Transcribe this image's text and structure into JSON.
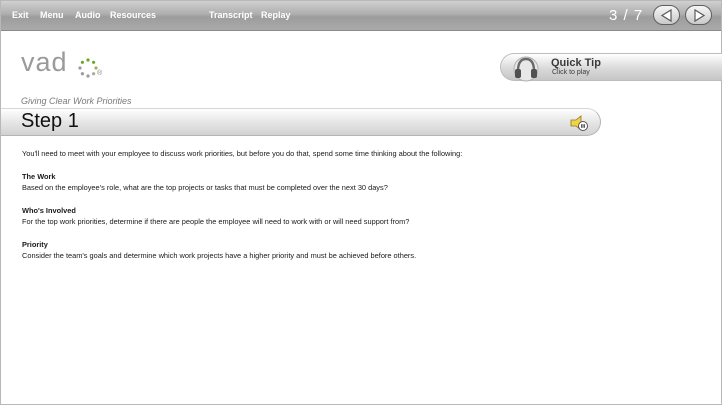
{
  "toolbar": {
    "items": [
      "Exit",
      "Menu",
      "Audio",
      "Resources",
      "Transcript",
      "Replay"
    ],
    "page_indicator": "3 / 7",
    "prev_icon": "triangle-left-icon",
    "next_icon": "triangle-right-icon"
  },
  "logo": {
    "text": "vad",
    "mark_icon": "dotted-o-logo-icon",
    "registered": "®"
  },
  "quick_tip": {
    "title": "Quick Tip",
    "subtitle": "Click to play",
    "icon": "headphones-icon"
  },
  "lesson": {
    "subtitle": "Giving Clear Work Priorities",
    "step_title": "Step 1",
    "step_icon": "audio-speaker-icon"
  },
  "content": {
    "intro": "You'll need to meet with your employee to discuss work priorities, but before you do that, spend some time thinking about the following:",
    "sections": [
      {
        "heading": "The Work",
        "text": "Based on the employee's role, what are the top projects or tasks that must be completed over the next 30 days?"
      },
      {
        "heading": "Who's Involved",
        "text": "For the top work priorities, determine if there are people the employee will need to work with or will need support from?"
      },
      {
        "heading": "Priority",
        "text": "Consider the team's goals and determine which work projects have a higher priority and must be achieved before others."
      }
    ]
  },
  "colors": {
    "toolbar": "#a9a9a9",
    "logo_gray": "#9a9a9a",
    "logo_green": "#6aa82c"
  }
}
